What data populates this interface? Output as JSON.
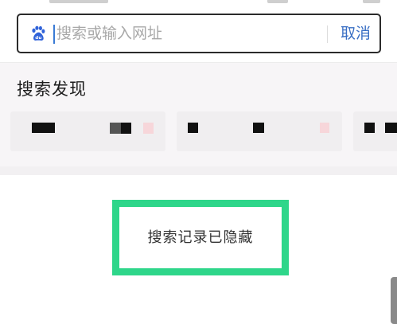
{
  "search": {
    "placeholder": "搜索或输入网址",
    "value": "",
    "cancel_label": "取消",
    "engine_icon": "baidu-paw-icon"
  },
  "discover": {
    "title": "搜索发现"
  },
  "history": {
    "hidden_message": "搜索记录已隐藏"
  },
  "colors": {
    "accent_blue": "#3a6fc4",
    "highlight_green": "#2ed68a",
    "baidu_blue": "#2f62d9"
  }
}
